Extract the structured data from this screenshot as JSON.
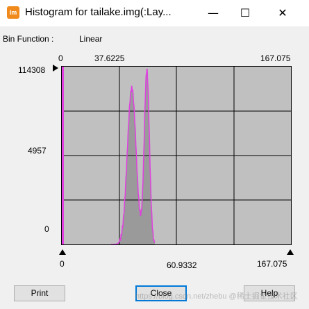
{
  "window": {
    "app_icon_text": "lm",
    "title": "Histogram for tailake.img(:Lay...",
    "minimize_glyph": "—",
    "maximize_glyph": "☐",
    "close_glyph": "✕"
  },
  "bin_function": {
    "label": "Bin Function :",
    "value": "Linear"
  },
  "top_axis": {
    "left": "0",
    "mid": "37.6225",
    "right": "167.075"
  },
  "y_axis": {
    "top": "114308",
    "mid": "4957",
    "bottom": "0"
  },
  "bottom_axis": {
    "left": "0",
    "mid": "60.9332",
    "right": "167.075"
  },
  "buttons": {
    "print": "Print",
    "close": "Close",
    "help": "Help"
  },
  "watermark": "https://blog.csdn.net/zhebu @稀土掘金技术社区",
  "colors": {
    "plot_bg": "#c0c0c0",
    "histogram_fill": "#9a9a9a",
    "histogram_line": "#e040e0",
    "grid": "#000000"
  },
  "chart_data": {
    "type": "area",
    "x_range": [
      0,
      167.075
    ],
    "y_labels": [
      "114308",
      "4957",
      "0"
    ],
    "peaks": [
      {
        "x": 51,
        "relative_height": 0.88
      },
      {
        "x": 62,
        "relative_height": 0.98
      }
    ],
    "trough": {
      "x": 57,
      "relative_height": 0.28
    },
    "spike_at_zero": true,
    "grid": true
  }
}
